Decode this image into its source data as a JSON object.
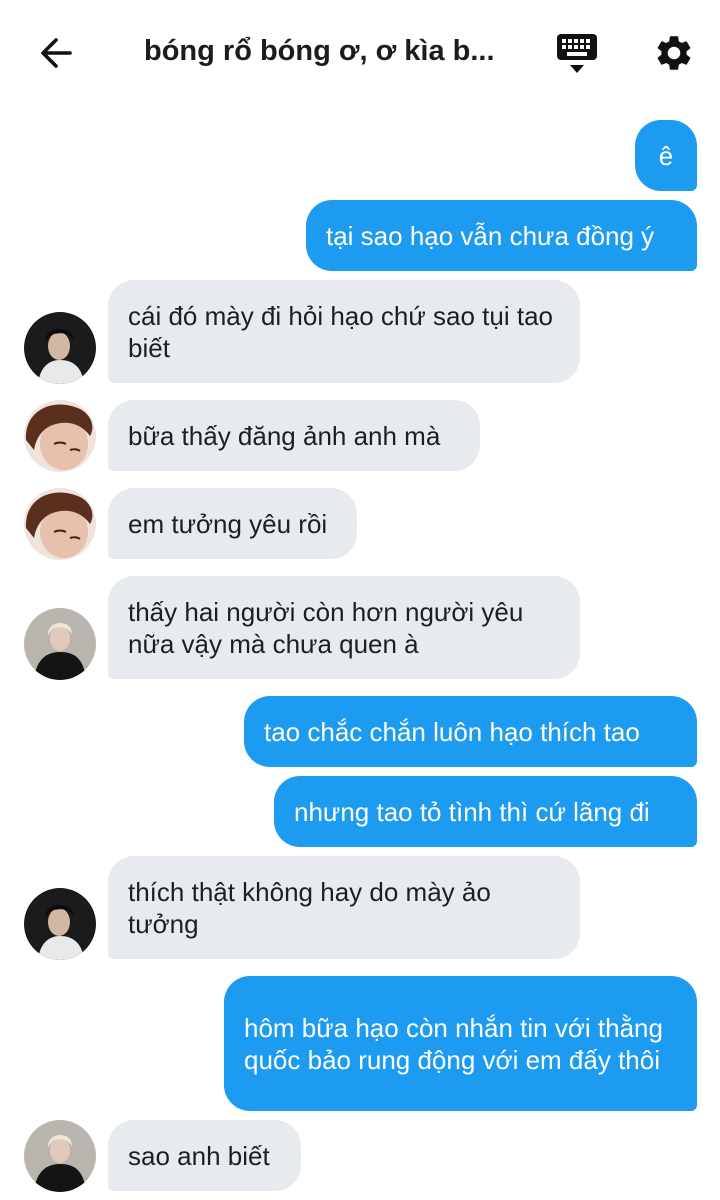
{
  "header": {
    "title": "bóng rổ bóng ơ, ơ kìa b...",
    "back_icon": "arrow-left-icon",
    "keyboard_icon": "keyboard-icon",
    "settings_icon": "gear-icon"
  },
  "colors": {
    "outgoing_bubble": "#1d9bf0",
    "incoming_bubble": "#e7ebef",
    "incoming_text": "#1f1f1f",
    "outgoing_text": "#ffffff"
  },
  "messages": [
    {
      "direction": "out",
      "text": "ê"
    },
    {
      "direction": "out",
      "text": "tại sao hạo vẫn chưa đồng ý"
    },
    {
      "direction": "in",
      "avatar": "avatar-dark-hair-white-shirt",
      "text": "cái đó mày đi hỏi hạo chứ sao tụi tao biết"
    },
    {
      "direction": "in",
      "avatar": "avatar-brown-hair-closeup",
      "text": "bữa thấy đăng ảnh anh mà"
    },
    {
      "direction": "in",
      "avatar": "avatar-brown-hair-closeup",
      "text": "em tưởng yêu rồi"
    },
    {
      "direction": "in",
      "avatar": "avatar-blond-black-jacket",
      "text": "thấy hai người còn hơn người yêu nữa vậy mà chưa quen à"
    },
    {
      "direction": "out",
      "text": "tao chắc chắn luôn hạo thích tao"
    },
    {
      "direction": "out",
      "text": "nhưng tao tỏ tình thì cứ lãng đi"
    },
    {
      "direction": "in",
      "avatar": "avatar-dark-hair-white-shirt",
      "text": "thích thật không hay do mày ảo tưởng"
    },
    {
      "direction": "out",
      "text": "hôm bữa hạo còn nhắn tin với thằng quốc bảo rung động với em đấy thôi"
    },
    {
      "direction": "in",
      "avatar": "avatar-blond-black-jacket",
      "text": "sao anh biết"
    }
  ]
}
